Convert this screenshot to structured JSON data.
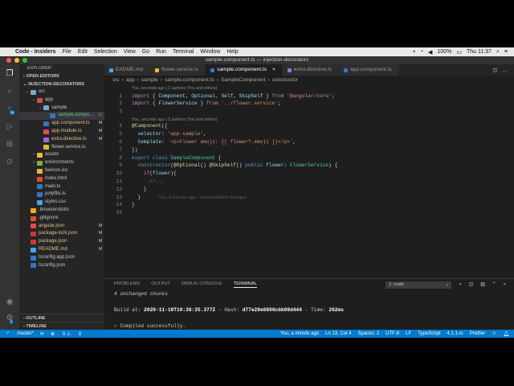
{
  "menubar": {
    "apple": "",
    "app": "Code - Insiders",
    "items": [
      "File",
      "Edit",
      "Selection",
      "View",
      "Go",
      "Run",
      "Terminal",
      "Window",
      "Help"
    ],
    "battery": "100%",
    "datetime": "Thu 11:37"
  },
  "window": {
    "title": "sample.component.ts — injection-decorators"
  },
  "sidebar": {
    "header": "EXPLORER",
    "open_editors": "OPEN EDITORS",
    "project": "INJECTION-DECORATORS",
    "outline": "OUTLINE",
    "timeline": "TIMELINE",
    "tree": [
      {
        "label": "src",
        "depth": 0,
        "kind": "folder",
        "open": true,
        "badge": "",
        "color": "#c5c5c5"
      },
      {
        "label": "app",
        "depth": 1,
        "kind": "folder",
        "open": true,
        "badge": "",
        "color": "#c5c5c5",
        "iconColor": "#e24b4b"
      },
      {
        "label": "sample",
        "depth": 2,
        "kind": "folder",
        "open": true,
        "badge": "",
        "color": "#c5c5c5"
      },
      {
        "label": "sample.compo...",
        "depth": 3,
        "kind": "ts",
        "badge": "U",
        "color": "#73c991",
        "selected": true,
        "iconColor": "#3178c6"
      },
      {
        "label": "app.component.ts",
        "depth": 2,
        "kind": "ts",
        "badge": "M",
        "color": "#e2c08d",
        "iconColor": "#3178c6"
      },
      {
        "label": "app.module.ts",
        "depth": 2,
        "kind": "ts",
        "badge": "M",
        "color": "#e2c08d",
        "iconColor": "#e24b4b"
      },
      {
        "label": "extra.directive.ts",
        "depth": 2,
        "kind": "ts",
        "badge": "M",
        "color": "#e2c08d",
        "iconColor": "#a06bd6"
      },
      {
        "label": "flower.service.ts",
        "depth": 2,
        "kind": "ts",
        "badge": "",
        "color": "#c5c5c5",
        "iconColor": "#e5b73b"
      },
      {
        "label": "assets",
        "depth": 1,
        "kind": "folder",
        "open": false,
        "badge": "",
        "color": "#c5c5c5",
        "iconColor": "#e8b84a"
      },
      {
        "label": "environments",
        "depth": 1,
        "kind": "folder",
        "open": false,
        "badge": "",
        "color": "#c5c5c5",
        "iconColor": "#7cb342"
      },
      {
        "label": "favicon.ico",
        "depth": 1,
        "kind": "file",
        "badge": "",
        "color": "#c5c5c5",
        "iconColor": "#e5b73b"
      },
      {
        "label": "index.html",
        "depth": 1,
        "kind": "file",
        "badge": "",
        "color": "#c5c5c5",
        "iconColor": "#e44d26"
      },
      {
        "label": "main.ts",
        "depth": 1,
        "kind": "ts",
        "badge": "",
        "color": "#c5c5c5",
        "iconColor": "#3178c6"
      },
      {
        "label": "polyfills.ts",
        "depth": 1,
        "kind": "ts",
        "badge": "",
        "color": "#c5c5c5",
        "iconColor": "#3178c6"
      },
      {
        "label": "styles.css",
        "depth": 1,
        "kind": "file",
        "badge": "",
        "color": "#c5c5c5",
        "iconColor": "#42a5f5"
      },
      {
        "label": ".browserslistrc",
        "depth": 0,
        "kind": "file",
        "badge": "",
        "color": "#c5c5c5",
        "iconColor": "#f5a623"
      },
      {
        "label": ".gitignore",
        "depth": 0,
        "kind": "file",
        "badge": "",
        "color": "#c5c5c5",
        "iconColor": "#e44d26"
      },
      {
        "label": "angular.json",
        "depth": 0,
        "kind": "file",
        "badge": "M",
        "color": "#e2c08d",
        "iconColor": "#e24b4b"
      },
      {
        "label": "package-lock.json",
        "depth": 0,
        "kind": "file",
        "badge": "M",
        "color": "#e2c08d",
        "iconColor": "#cb3837"
      },
      {
        "label": "package.json",
        "depth": 0,
        "kind": "file",
        "badge": "M",
        "color": "#e2c08d",
        "iconColor": "#cb3837"
      },
      {
        "label": "README.md",
        "depth": 0,
        "kind": "file",
        "badge": "M",
        "color": "#e2c08d",
        "iconColor": "#42a5f5"
      },
      {
        "label": "tsconfig.app.json",
        "depth": 0,
        "kind": "file",
        "badge": "",
        "color": "#c5c5c5",
        "iconColor": "#3178c6"
      },
      {
        "label": "tsconfig.json",
        "depth": 0,
        "kind": "file",
        "badge": "",
        "color": "#c5c5c5",
        "iconColor": "#3178c6"
      }
    ]
  },
  "tabs": [
    {
      "label": "EADME.md",
      "active": false,
      "iconColor": "#42a5f5"
    },
    {
      "label": "flower.service.ts",
      "active": false,
      "iconColor": "#e5b73b"
    },
    {
      "label": "sample.component.ts",
      "active": true,
      "close": "×",
      "iconColor": "#3178c6"
    },
    {
      "label": "extra.directive.ts",
      "active": false,
      "iconColor": "#a06bd6"
    },
    {
      "label": "app.component.ts",
      "active": false,
      "iconColor": "#3178c6"
    }
  ],
  "breadcrumbs": [
    "src",
    "app",
    "sample",
    "sample.component.ts",
    "SampleComponent",
    "constructor"
  ],
  "breadcrumb_sep": "›",
  "code": {
    "lens1": "You, seconds ago | 2 authors (You and others)",
    "lens2": "You, seconds ago | 2 authors (You and others)",
    "lines": [
      {
        "n": "1",
        "html": "<span class='kc'>import</span> { <span class='v'>Component</span>, <span class='v'>Optional</span>, <span class='v'>Self</span>, <span class='v'>SkipSelf</span> } <span class='kc'>from</span> <span class='s'>'@angular/core'</span>;"
      },
      {
        "n": "2",
        "html": "<span class='kc'>import</span> { <span class='v'>FlowerService</span> } <span class='kc'>from</span> <span class='s'>'../flower.service'</span>;"
      },
      {
        "n": "3",
        "html": ""
      },
      {
        "n": "4",
        "html": "<span class='f'>@Component</span>({"
      },
      {
        "n": "5",
        "html": "  <span class='v'>selector</span>: <span class='s'>'app-sample'</span>,"
      },
      {
        "n": "6",
        "html": "  <span class='v'>template</span>: <span class='s'>`&lt;p&gt;Flower emoji: {{ flower?.emoji }}&lt;/p&gt;`</span>,"
      },
      {
        "n": "7",
        "html": "})"
      },
      {
        "n": "8",
        "html": "<span class='k'>export</span> <span class='k'>class</span> <span class='t'>SampleComponent</span> {"
      },
      {
        "n": "9",
        "html": "  <span class='k'>constructor</span>(<span class='f'>@Optional</span>() <span class='f'>@SkipSelf</span>() <span class='k'>public</span> <span class='v'>flower</span>: <span class='t'>FlowerService</span>) {"
      },
      {
        "n": "10",
        "html": "    <span class='kc'>if</span>(<span class='v'>flower</span>){"
      },
      {
        "n": "11",
        "html": "      <span class='c'>//...</span>"
      },
      {
        "n": "12",
        "html": "    }"
      },
      {
        "n": "13",
        "html": "  }"
      },
      {
        "n": "14",
        "html": "}"
      },
      {
        "n": "15",
        "html": ""
      }
    ],
    "ghost": "You, a minute ago • Uncommitted changes"
  },
  "panel": {
    "tabs": [
      "PROBLEMS",
      "OUTPUT",
      "DEBUG CONSOLE",
      "TERMINAL"
    ],
    "terminal_select": "1: node",
    "icons": [
      "plus-icon",
      "split-icon",
      "trash-icon",
      "chevron-up-icon",
      "close-icon"
    ],
    "lines": [
      "4 unchanged chunks",
      "",
      "Build at: 2020-11-19T10:36:35.377Z - Hash: d77e29e6806cbb08d444 - Time: 262ms",
      "",
      "✓ Compiled successfully.",
      ""
    ]
  },
  "status": {
    "branch": "master*",
    "sync": "⟳",
    "errors": "0",
    "warnings": "0",
    "blame": "You, a minute ago",
    "position": "Ln 13, Col 4",
    "spaces": "Spaces: 2",
    "encoding": "UTF-8",
    "eol": "LF",
    "language": "TypeScript",
    "version": "4.1.1-rc",
    "formatter": "Prettier"
  },
  "colors": {
    "accent": "#007acc",
    "untracked": "#73c991",
    "modified": "#e2c08d"
  }
}
